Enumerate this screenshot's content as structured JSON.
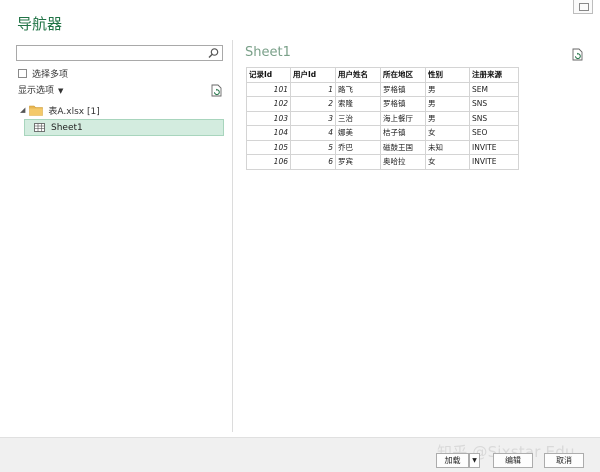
{
  "window": {
    "title": "导航器"
  },
  "left_pane": {
    "search": {
      "value": "",
      "placeholder": ""
    },
    "multi_select_label": "选择多项",
    "display_options_label": "显示选项",
    "tree": {
      "file_label": "表A.xlsx [1]",
      "sheet_label": "Sheet1"
    }
  },
  "preview": {
    "title": "Sheet1",
    "columns": [
      "记录Id",
      "用户Id",
      "用户姓名",
      "所在地区",
      "性别",
      "注册来源"
    ],
    "rows": [
      [
        "101",
        "1",
        "路飞",
        "罗格镇",
        "男",
        "SEM"
      ],
      [
        "102",
        "2",
        "索隆",
        "罗格镇",
        "男",
        "SNS"
      ],
      [
        "103",
        "3",
        "三治",
        "海上餐厅",
        "男",
        "SNS"
      ],
      [
        "104",
        "4",
        "娜美",
        "桔子镇",
        "女",
        "SEO"
      ],
      [
        "105",
        "5",
        "乔巴",
        "磁鼓王国",
        "未知",
        "INVITE"
      ],
      [
        "106",
        "6",
        "罗宾",
        "奥哈拉",
        "女",
        "INVITE"
      ]
    ]
  },
  "footer": {
    "load_label": "加载",
    "edit_label": "编辑",
    "cancel_label": "取消",
    "watermark": "知乎 @Sixstar Edu"
  },
  "colors": {
    "accent": "#217346",
    "selection": "#d3ecdf"
  }
}
